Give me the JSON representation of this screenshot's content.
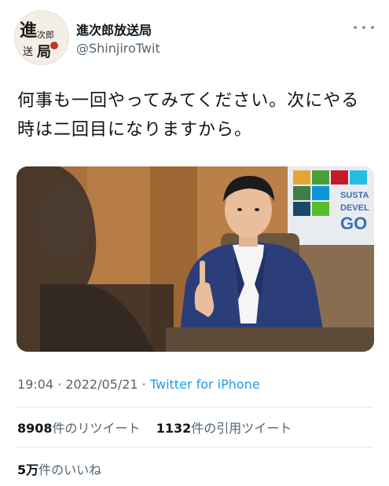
{
  "author": {
    "display_name": "進次郎放送局",
    "handle": "@ShinjiroTwit",
    "avatar_text": "進次郎放送局"
  },
  "tweet": {
    "text": "何事も一回やってみてください。次にやる時は二回目になりますから。"
  },
  "photo": {
    "poster_texts": [
      "SUSTA",
      "DEVEL",
      "GO"
    ]
  },
  "meta": {
    "time": "19:04",
    "separator1": " · ",
    "date": "2022/05/21",
    "separator2": " · ",
    "source": "Twitter for iPhone"
  },
  "stats": {
    "retweets_count": "8908",
    "retweets_label": "件のリツイート",
    "quotes_count": "1132",
    "quotes_label": "件の引用ツイート",
    "likes_count": "5万",
    "likes_label": "件のいいね"
  },
  "colors": {
    "link": "#1d9bf0",
    "secondary_text": "#536471",
    "primary_text": "#0f1419"
  },
  "icons": [
    "more-icon"
  ]
}
